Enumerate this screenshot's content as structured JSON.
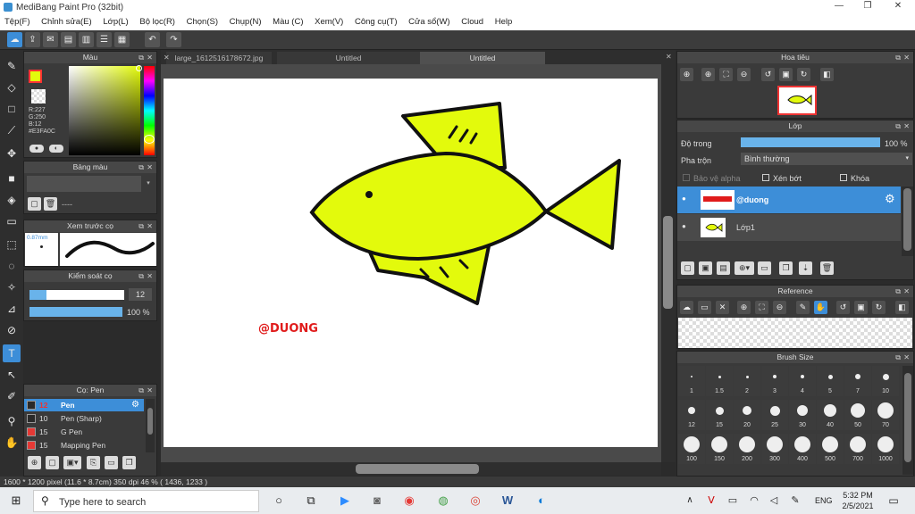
{
  "app": {
    "title": "MediBang Paint Pro (32bit)"
  },
  "menu": [
    "Tệp(F)",
    "Chỉnh sửa(E)",
    "Lớp(L)",
    "Bộ lọc(R)",
    "Chọn(S)",
    "Chụp(N)",
    "Màu (C)",
    "Xem(V)",
    "Công cụ(T)",
    "Cửa sổ(W)",
    "Cloud",
    "Help"
  ],
  "color_panel": {
    "title": "Màu",
    "r": "R:227",
    "g": "G:250",
    "b": "B:12",
    "hex": "#E3FA0C",
    "fg": "#e3fa0c",
    "bg": "#ffffff"
  },
  "palette_panel": {
    "title": "Bảng màu",
    "placeholder": "----"
  },
  "brush_preview": {
    "title": "Xem trước cọ",
    "size": "0.87mm"
  },
  "brush_control": {
    "title": "Kiểm soát cọ",
    "size": "12",
    "opacity": "100 %",
    "size_fraction": 0.18,
    "opacity_fraction": 1.0
  },
  "brush_panel": {
    "title": "Cọ: Pen",
    "items": [
      {
        "size": "12",
        "name": "Pen",
        "color": "#2a2a2a",
        "selected": true
      },
      {
        "size": "10",
        "name": "Pen (Sharp)",
        "color": "#2a2a2a",
        "selected": false
      },
      {
        "size": "15",
        "name": "G Pen",
        "color": "#e53935",
        "selected": false
      },
      {
        "size": "15",
        "name": "Mapping Pen",
        "color": "#e53935",
        "selected": false
      }
    ]
  },
  "tabs": [
    {
      "label": "large_1612516178672.jpg",
      "active": false
    },
    {
      "label": "Untitled",
      "active": false
    },
    {
      "label": "Untitled",
      "active": true
    }
  ],
  "canvas": {
    "signature": "@DUONG"
  },
  "navigator": {
    "title": "Hoa tiêu"
  },
  "layer_panel": {
    "title": "Lớp",
    "opacity_label": "Độ trong",
    "opacity_value": "100 %",
    "opacity_fraction": 1.0,
    "blend_label": "Pha trộn",
    "blend_value": "Bình thường",
    "alpha_label": "Bảo vệ alpha",
    "clip_label": "Xén bớt",
    "lock_label": "Khóa",
    "layers": [
      {
        "name": "@duong",
        "selected": true
      },
      {
        "name": "Lớp1",
        "selected": false
      }
    ]
  },
  "reference_panel": {
    "title": "Reference"
  },
  "brush_size_panel": {
    "title": "Brush Size",
    "sizes": [
      "1",
      "1.5",
      "2",
      "3",
      "4",
      "5",
      "7",
      "10",
      "12",
      "15",
      "20",
      "25",
      "30",
      "40",
      "50",
      "70",
      "100",
      "150",
      "200",
      "300",
      "400",
      "500",
      "700",
      "1000"
    ]
  },
  "status": {
    "text": "1600 * 1200 pixel   (11.6 * 8.7cm)   350 dpi   46 %   ( 1436, 1233 )"
  },
  "taskbar": {
    "search_placeholder": "Type here to search",
    "lang": "ENG",
    "time": "5:32 PM",
    "date": "2/5/2021"
  }
}
